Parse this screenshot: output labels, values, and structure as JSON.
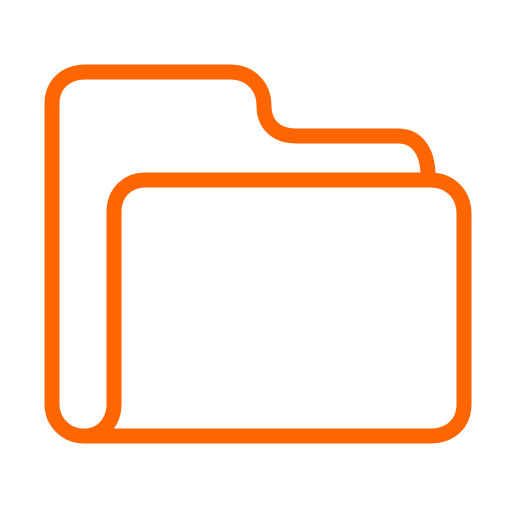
{
  "icon": {
    "name": "folder-icon",
    "stroke_color": "#FF6600",
    "background_color": "#FFFFFF",
    "fill": "none"
  }
}
